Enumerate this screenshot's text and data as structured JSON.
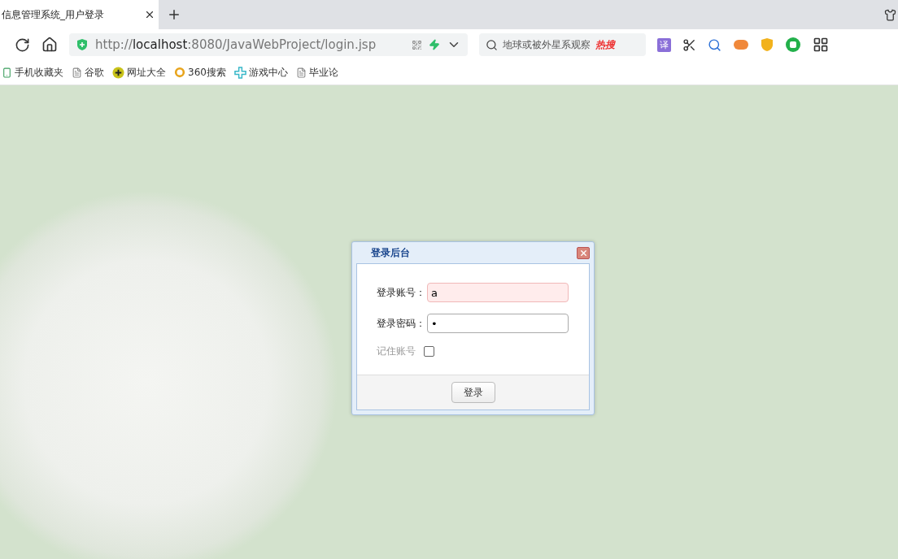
{
  "tab": {
    "title": "信息管理系统_用户登录",
    "selected": true
  },
  "address": {
    "scheme": "http://",
    "host": "localhost",
    "rest": ":8080/JavaWebProject/login.jsp"
  },
  "search": {
    "placeholder": "地球或被外星系观察",
    "hot": "热搜"
  },
  "toolbar": {
    "translate": "译"
  },
  "bookmarks": [
    {
      "label": "手机收藏夹",
      "kind": "phone"
    },
    {
      "label": "谷歌",
      "kind": "page"
    },
    {
      "label": "网址大全",
      "kind": "plus"
    },
    {
      "label": "360搜索",
      "kind": "ring"
    },
    {
      "label": "游戏中心",
      "kind": "game"
    },
    {
      "label": "毕业论",
      "kind": "page"
    }
  ],
  "dialog": {
    "title": "登录后台",
    "fields": [
      {
        "label": "登录账号：",
        "value": "a",
        "invalid": true
      },
      {
        "label": "登录密码：",
        "value": "•",
        "invalid": false
      }
    ],
    "remember": {
      "label": "记住账号",
      "checked": false
    },
    "button": "登录"
  }
}
